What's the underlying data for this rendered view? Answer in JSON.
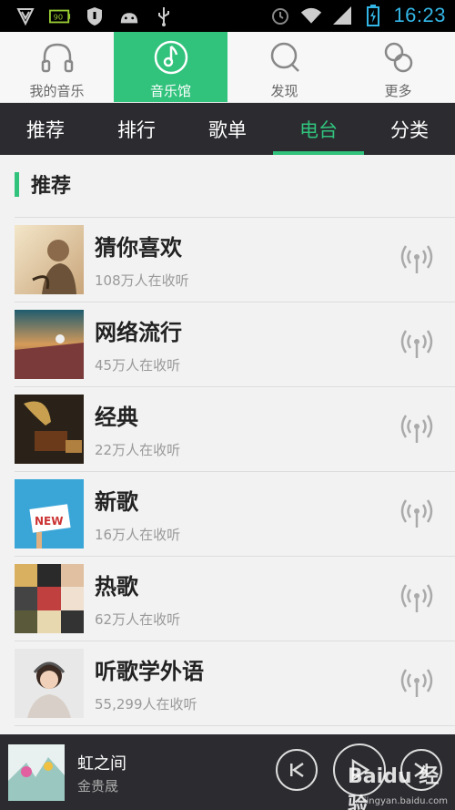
{
  "status_bar": {
    "time": "16:23",
    "battery_badge": "90"
  },
  "top_nav": {
    "items": [
      {
        "label": "我的音乐",
        "icon": "headphones-icon"
      },
      {
        "label": "音乐馆",
        "icon": "music-note-icon",
        "active": true
      },
      {
        "label": "发现",
        "icon": "search-icon"
      },
      {
        "label": "更多",
        "icon": "more-circles-icon"
      }
    ]
  },
  "sub_tabs": {
    "items": [
      {
        "label": "推荐"
      },
      {
        "label": "排行"
      },
      {
        "label": "歌单"
      },
      {
        "label": "电台",
        "active": true
      },
      {
        "label": "分类"
      }
    ]
  },
  "section": {
    "title": "推荐"
  },
  "stations": [
    {
      "title": "猜你喜欢",
      "listeners": "108万人在收听"
    },
    {
      "title": "网络流行",
      "listeners": "45万人在收听"
    },
    {
      "title": "经典",
      "listeners": "22万人在收听"
    },
    {
      "title": "新歌",
      "listeners": "16万人在收听"
    },
    {
      "title": "热歌",
      "listeners": "62万人在收听"
    },
    {
      "title": "听歌学外语",
      "listeners": "55,299人在收听"
    }
  ],
  "player": {
    "title": "虹之间",
    "artist": "金贵晟"
  },
  "watermark": {
    "logo": "Baidu 经验",
    "url": "jingyan.baidu.com"
  },
  "colors": {
    "accent": "#31c27c",
    "dark_bar": "#2b2b30",
    "status_blue": "#33b5e5"
  }
}
